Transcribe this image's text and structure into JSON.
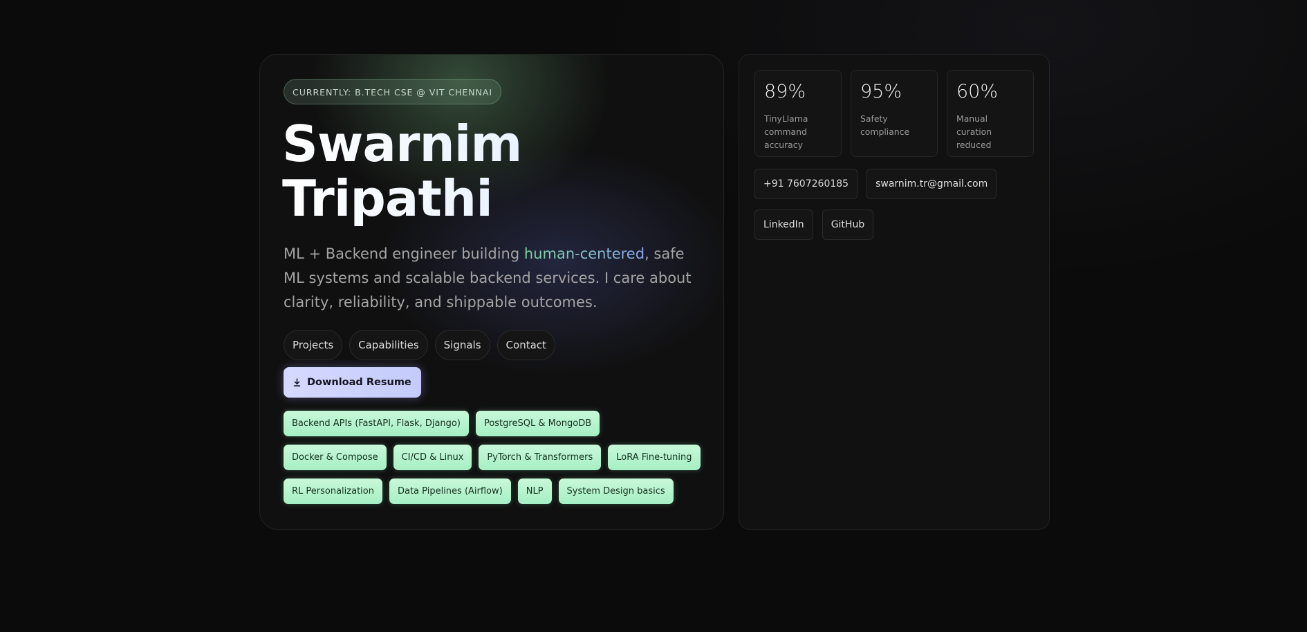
{
  "hero": {
    "status": "CURRENTLY: B.TECH CSE @ VIT CHENNAI",
    "name_line1": "Swarnim",
    "name_line2": "Tripathi",
    "tagline_before": "ML + Backend engineer building ",
    "tagline_highlight": "human-centered",
    "tagline_after": ", safe ML systems and scalable backend services. I care about clarity, reliability, and shippable outcomes.",
    "nav": [
      "Projects",
      "Capabilities",
      "Signals",
      "Contact"
    ],
    "resume_label": "Download Resume",
    "skills": [
      "Backend APIs (FastAPI, Flask, Django)",
      "PostgreSQL & MongoDB",
      "Docker & Compose",
      "CI/CD & Linux",
      "PyTorch & Transformers",
      "LoRA Fine-tuning",
      "RL Personalization",
      "Data Pipelines (Airflow)",
      "NLP",
      "System Design basics"
    ]
  },
  "side": {
    "stats": [
      {
        "value": "89%",
        "label": "TinyLlama command accuracy"
      },
      {
        "value": "95%",
        "label": "Safety compliance"
      },
      {
        "value": "60%",
        "label": "Manual curation reduced"
      }
    ],
    "contacts": {
      "phone": "+91 7607260185",
      "email": "swarnim.tr@gmail.com",
      "linkedin": "LinkedIn",
      "github": "GitHub"
    }
  },
  "icons": {
    "download": "download-icon"
  },
  "colors": {
    "background": "#0b0b0b",
    "skill_chip": "#b8f4d0",
    "resume_button": "#d0d4ff",
    "highlight_start": "#7fd6a0",
    "highlight_end": "#8ea8f0"
  }
}
